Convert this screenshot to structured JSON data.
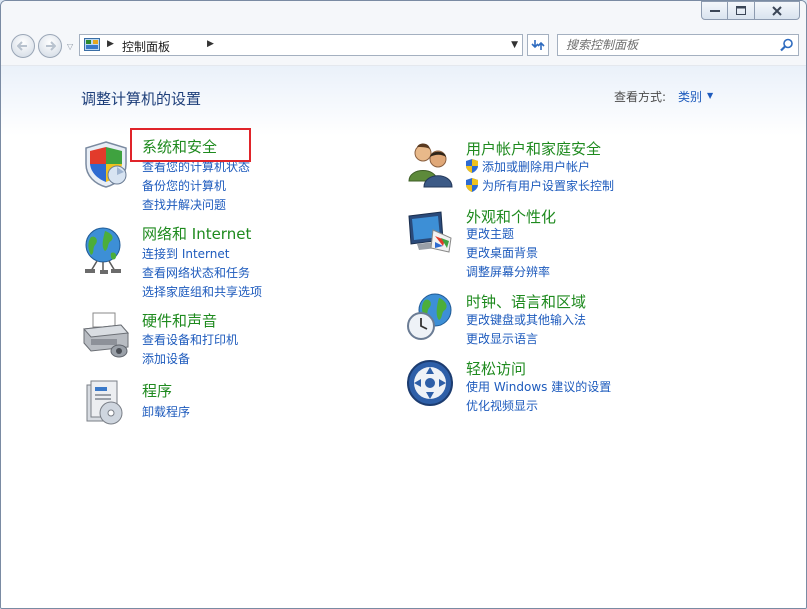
{
  "window": {
    "minimize_label": "—",
    "maximize_label": "☐",
    "close_label": "✕"
  },
  "nav": {
    "breadcrumb": "控制面板",
    "search_placeholder": "搜索控制面板"
  },
  "header": {
    "title": "调整计算机的设置",
    "view_by_label": "查看方式:",
    "view_by_value": "类别"
  },
  "categories_left": [
    {
      "title": "系统和安全",
      "links": [
        "查看您的计算机状态",
        "备份您的计算机",
        "查找并解决问题"
      ],
      "icon": "shield-icon"
    },
    {
      "title": "网络和 Internet",
      "links": [
        "连接到 Internet",
        "查看网络状态和任务",
        "选择家庭组和共享选项"
      ],
      "icon": "network-globe-icon"
    },
    {
      "title": "硬件和声音",
      "links": [
        "查看设备和打印机",
        "添加设备"
      ],
      "icon": "printer-icon"
    },
    {
      "title": "程序",
      "links": [
        "卸载程序"
      ],
      "icon": "programs-icon"
    }
  ],
  "categories_right": [
    {
      "title": "用户帐户和家庭安全",
      "links": [
        "添加或删除用户帐户",
        "为所有用户设置家长控制"
      ],
      "icon": "users-icon"
    },
    {
      "title": "外观和个性化",
      "links": [
        "更改主题",
        "更改桌面背景",
        "调整屏幕分辨率"
      ],
      "icon": "monitor-paint-icon"
    },
    {
      "title": "时钟、语言和区域",
      "links": [
        "更改键盘或其他输入法",
        "更改显示语言"
      ],
      "icon": "clock-globe-icon"
    },
    {
      "title": "轻松访问",
      "links": [
        "使用 Windows 建议的设置",
        "优化视频显示"
      ],
      "icon": "ease-of-access-icon"
    }
  ],
  "colors": {
    "category_title": "#1e8a1e",
    "link": "#1e5bbd",
    "highlight_box": "#e0242a"
  }
}
